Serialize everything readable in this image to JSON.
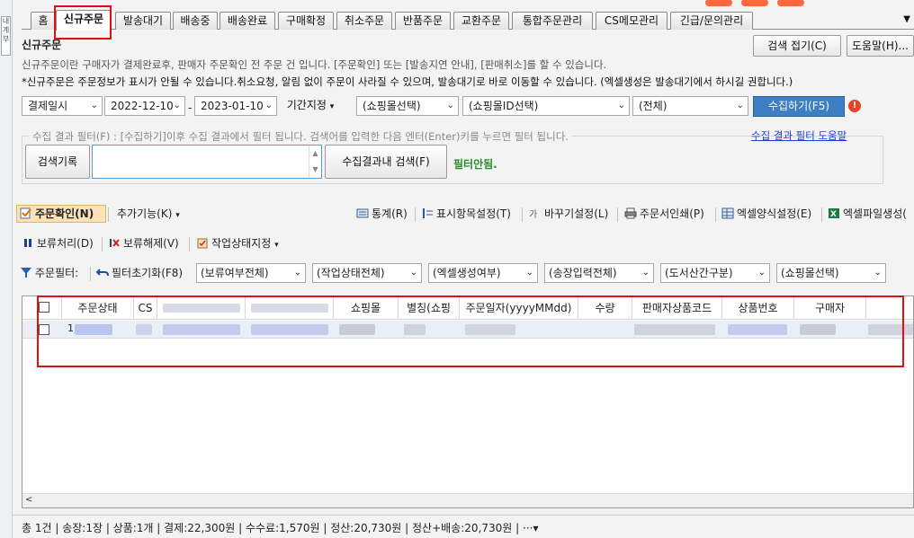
{
  "left_strip": {
    "label": "내\n계\n부"
  },
  "tabs": [
    {
      "label": "홈",
      "active": false
    },
    {
      "label": "신규주문",
      "active": true
    },
    {
      "label": "발송대기",
      "active": false
    },
    {
      "label": "배송중",
      "active": false
    },
    {
      "label": "배송완료",
      "active": false
    },
    {
      "label": "구매확정",
      "active": false
    },
    {
      "label": "취소주문",
      "active": false
    },
    {
      "label": "반품주문",
      "active": false
    },
    {
      "label": "교환주문",
      "active": false
    },
    {
      "label": "통합주문관리",
      "active": false
    },
    {
      "label": "CS메모관리",
      "active": false
    },
    {
      "label": "긴급/문의관리",
      "active": false
    }
  ],
  "header": {
    "title": "신규주문",
    "collapse_label": "검색 접기(C)",
    "help_label": "도움말(H)...",
    "desc1": "신규주문이란 구매자가 결제완료후, 판매자 주문확인 전 주문 건 입니다. [주문확인] 또는 [발송지연 안내], [판매취소]를 할 수 있습니다.",
    "desc2": "*신규주문은 주문정보가 표시가 안될 수 있습니다.취소요청, 알림 없이 주문이 사라질 수 있으며, 발송대기로 바로 이동할 수 있습니다. (엑셀생성은 발송대기에서 하시길 권합니다.)"
  },
  "filters": {
    "date_type": "결제일시",
    "date_from": "2022-12-10",
    "date_to": "2023-01-10",
    "dash": "-",
    "period_label": "기간지정",
    "mall_select": "(쇼핑몰선택)",
    "mall_id_select": "(쇼핑몰ID선택)",
    "all_select": "(전체)",
    "collect_button": "수집하기(F5)",
    "alert_glyph": "!"
  },
  "result_filter": {
    "legend": "수집 결과 필터(F) : [수집하기]이후 수집 결과에서 필터 됩니다. 검색어를 입력한 다음 엔터(Enter)키를 누르면 필터 됩니다.",
    "help_link": "수집 결과 필터 도움말",
    "history_button": "검색기록",
    "search_value": "",
    "search_in_results_button": "수집결과내 검색(F)",
    "status": "필터안됨."
  },
  "toolbar1": {
    "confirm": "주문확인(N)",
    "more": "추가기능(K)",
    "stats": "통계(R)",
    "display_settings": "표시항목설정(T)",
    "basket_settings": "바꾸기설정(L)",
    "print": "주문서인쇄(P)",
    "excel_format": "엑셀양식설정(E)",
    "excel_create": "엑셀파일생성("
  },
  "toolbar2": {
    "hold": "보류처리(D)",
    "unhold": "보류해제(V)",
    "work_status": "작업상태지정"
  },
  "toolbar3": {
    "label": "주문필터:",
    "reset": "필터초기화(F8)",
    "hold_all": "(보류여부전체)",
    "work_all": "(작업상태전체)",
    "excel_created": "(엑셀생성여부)",
    "invoice_all": "(송장입력전체)",
    "island": "(도서산간구분)",
    "mall_select": "(쇼핑몰선택)"
  },
  "grid": {
    "columns": [
      "주문상태",
      "CS",
      "",
      "",
      "쇼핑몰",
      "별칭(쇼핑",
      "주문일자(yyyyMMdd)",
      "수량",
      "판매자상품코드",
      "상품번호",
      "구매자"
    ],
    "row_first_char": "1"
  },
  "status_bar": {
    "text": "총 1건 | 송장:1장 | 상품:1개 | 결제:22,300원 | 수수료:1,570원 | 정산:20,730원 | 정산+배송:20,730원 |",
    "more": "···▾"
  }
}
